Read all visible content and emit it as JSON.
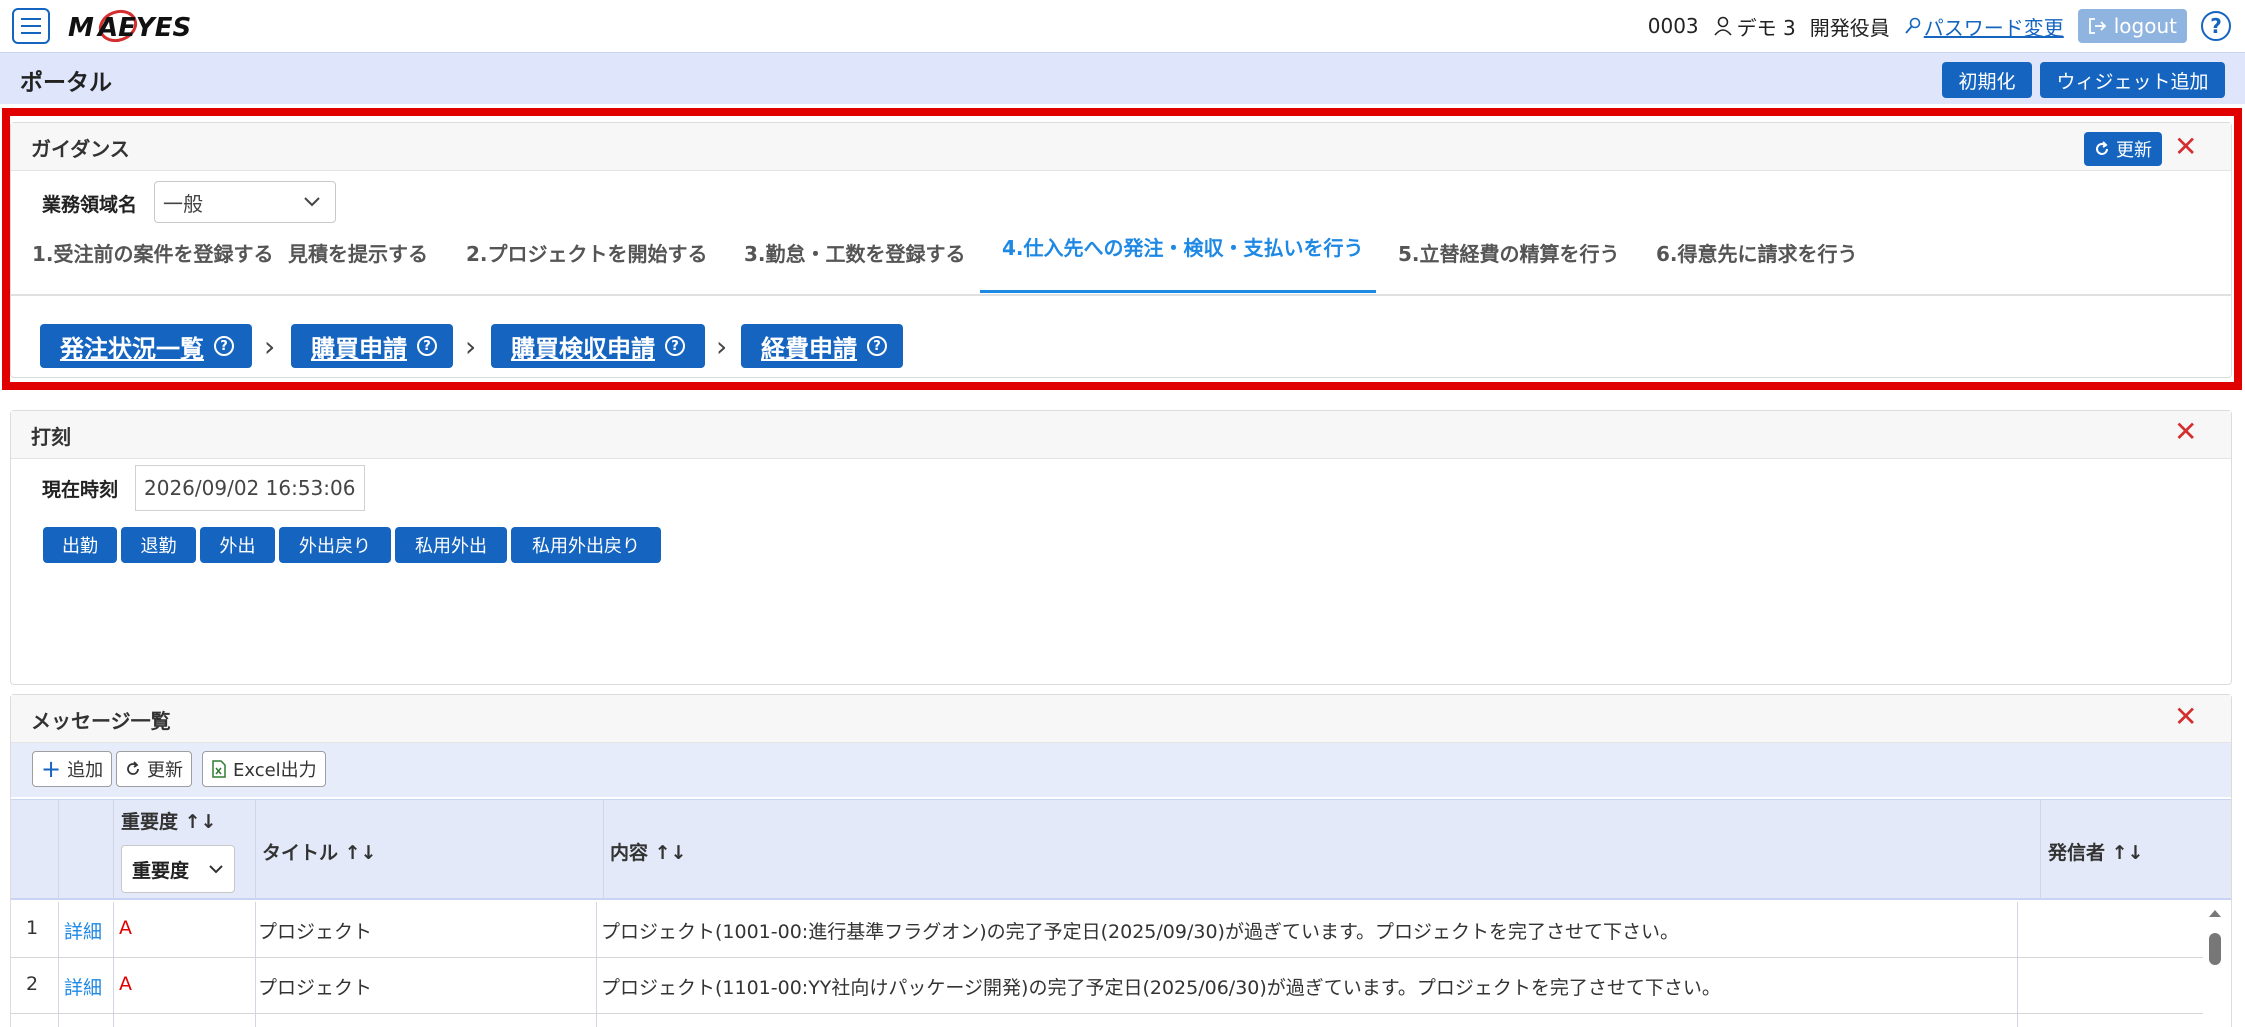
{
  "header": {
    "user_code": "0003",
    "user_name": "デモ 3",
    "role": "開発役員",
    "password_link": "パスワード変更",
    "logout_label": "logout",
    "help_label": "?"
  },
  "logo_text": "MAEYES",
  "page": {
    "title": "ポータル",
    "init_label": "初期化",
    "add_widget_label": "ウィジェット追加"
  },
  "guidance": {
    "title": "ガイダンス",
    "refresh_label": "更新",
    "area_label": "業務領域名",
    "area_value": "一般",
    "tabs": [
      "1.受注前の案件を登録する",
      "見積を提示する",
      "2.プロジェクトを開始する",
      "3.勤怠・工数を登録する",
      "4.仕入先への発注・検収・支払いを行う",
      "5.立替経費の精算を行う",
      "6.得意先に請求を行う"
    ],
    "active_tab": 4,
    "flow": [
      "発注状況一覧",
      "購買申請",
      "購買検収申請",
      "経費申請"
    ]
  },
  "stamp": {
    "title": "打刻",
    "time_label": "現在時刻",
    "time_value": "2026/09/02 16:53:06",
    "buttons": [
      "出勤",
      "退勤",
      "外出",
      "外出戻り",
      "私用外出",
      "私用外出戻り"
    ]
  },
  "messages": {
    "title": "メッセージ一覧",
    "toolbar": {
      "add": "追加",
      "refresh": "更新",
      "excel": "Excel出力"
    },
    "columns": {
      "importance": "重要度 ↑↓",
      "importance_filter": "重要度",
      "title": "タイトル ↑↓",
      "content": "内容 ↑↓",
      "sender": "発信者 ↑↓"
    },
    "rows": [
      {
        "no": "1",
        "detail": "詳細",
        "importance": "A",
        "title": "プロジェクト",
        "content": "プロジェクト(1001-00:進行基準フラグオン)の完了予定日(2025/09/30)が過ぎています。プロジェクトを完了させて下さい。",
        "sender": ""
      },
      {
        "no": "2",
        "detail": "詳細",
        "importance": "A",
        "title": "プロジェクト",
        "content": "プロジェクト(1101-00:YY社向けパッケージ開発)の完了予定日(2025/06/30)が過ぎています。プロジェクトを完了させて下さい。",
        "sender": ""
      }
    ]
  },
  "colors": {
    "primary": "#1565c0",
    "accent": "#1e88e5",
    "danger": "#d32f2f",
    "highlight": "#e00000"
  }
}
